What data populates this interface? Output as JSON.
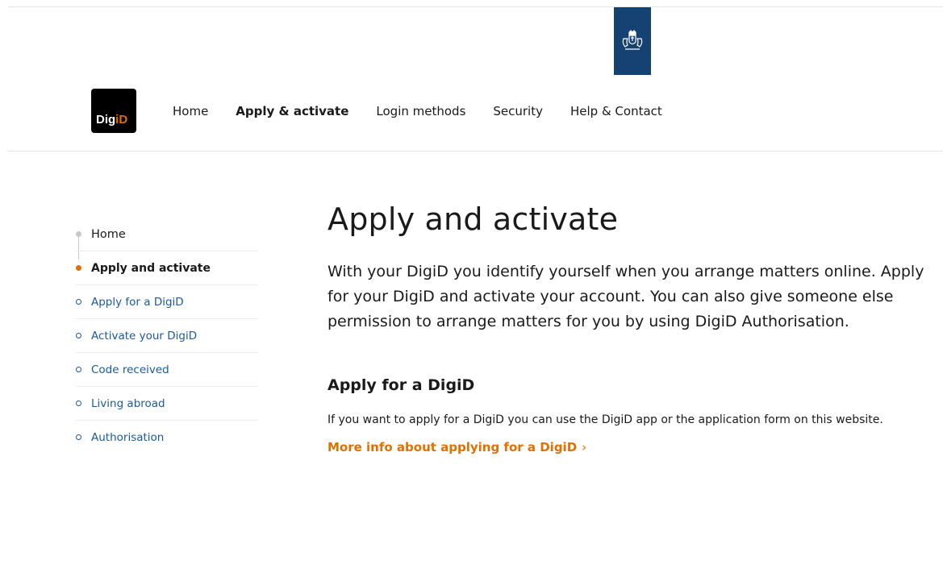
{
  "logo": {
    "part1": "Dig",
    "part2": "iD"
  },
  "nav": {
    "items": [
      {
        "label": "Home"
      },
      {
        "label": "Apply & activate"
      },
      {
        "label": "Login methods"
      },
      {
        "label": "Security"
      },
      {
        "label": "Help & Contact"
      }
    ],
    "active_index": 1
  },
  "sidebar": {
    "home": "Home",
    "current": "Apply and activate",
    "children": [
      {
        "label": "Apply for a DigiD"
      },
      {
        "label": "Activate your DigiD"
      },
      {
        "label": "Code received"
      },
      {
        "label": "Living abroad"
      },
      {
        "label": "Authorisation"
      }
    ]
  },
  "main": {
    "title": "Apply and activate",
    "intro": "With your DigiD you identify yourself when you arrange matters online. Apply for your DigiD and activate your account. You can also give someone else permission to arrange matters for you by using DigiD Authorisation.",
    "section": {
      "title": "Apply for a DigiD",
      "body": "If you want to apply for a DigiD you can use the DigiD app or the application form on this website.",
      "link": "More info about applying for a DigiD",
      "link_chevron": "›"
    }
  },
  "colors": {
    "accent": "#e17000",
    "crest_bg": "#154273",
    "link_blue": "#1c5a9e"
  }
}
